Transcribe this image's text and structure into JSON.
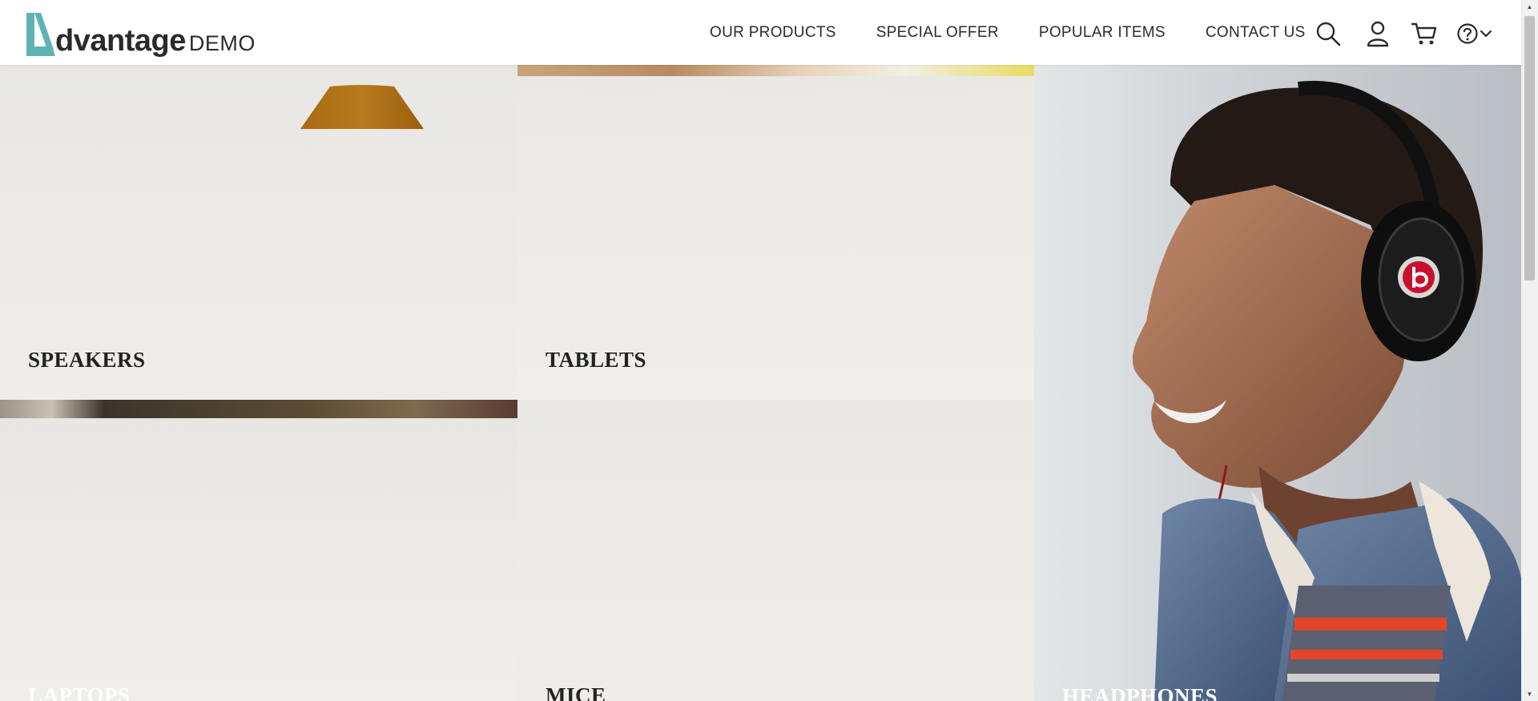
{
  "brand": {
    "name": "dvantage",
    "suffix": "DEMO",
    "accent_color": "#5fb3b3"
  },
  "nav": {
    "items": [
      {
        "label": "OUR PRODUCTS"
      },
      {
        "label": "SPECIAL OFFER"
      },
      {
        "label": "POPULAR ITEMS"
      },
      {
        "label": "CONTACT US"
      }
    ]
  },
  "header_icons": [
    "search-icon",
    "user-icon",
    "cart-icon",
    "help-icon",
    "chevron-down-icon"
  ],
  "categories": [
    {
      "label": "SPEAKERS"
    },
    {
      "label": "TABLETS"
    },
    {
      "label": "LAPTOPS"
    },
    {
      "label": "MICE"
    },
    {
      "label": "HEADPHONES"
    }
  ]
}
